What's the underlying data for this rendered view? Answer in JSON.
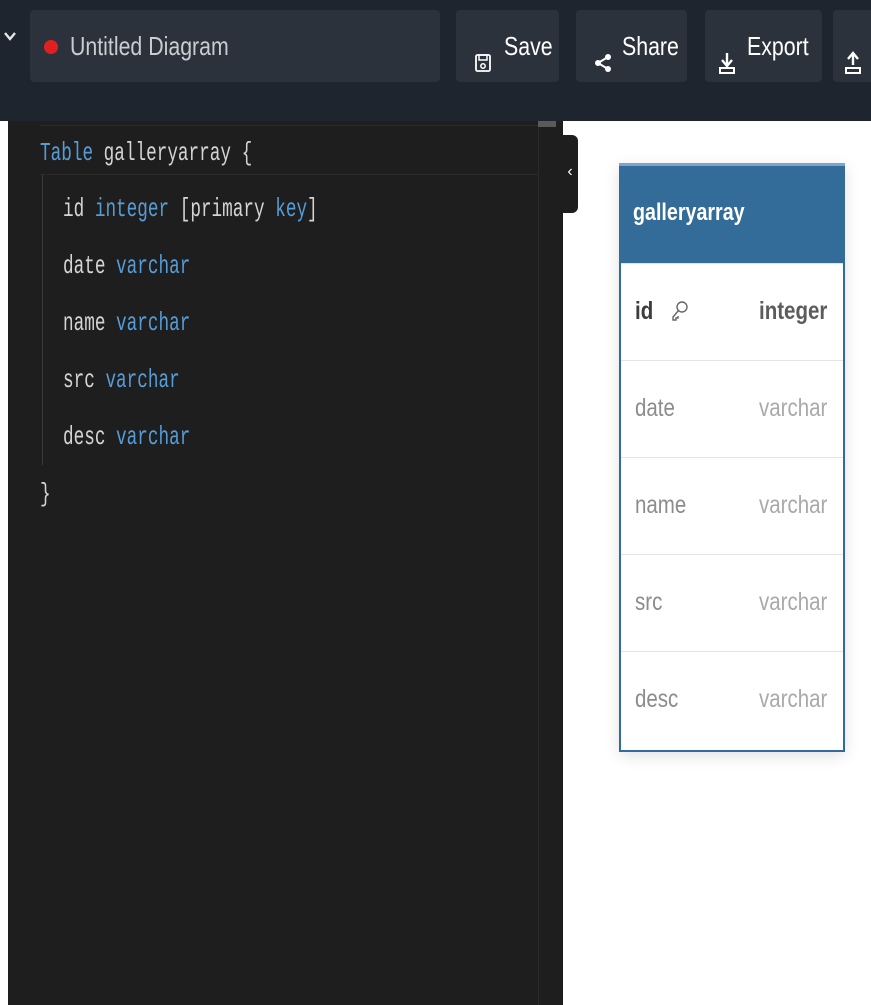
{
  "topbar": {
    "diagram_title": "Untitled Diagram",
    "save_label": "Save",
    "share_label": "Share",
    "export_label": "Export",
    "status_color": "#e02020"
  },
  "editor": {
    "lines": [
      {
        "parts": [
          {
            "text": "Table",
            "kind": "keyword"
          },
          {
            "text": " galleryarray {",
            "kind": "plain"
          }
        ]
      },
      {
        "parts": [
          {
            "text": "id",
            "kind": "plain"
          },
          {
            "text": " integer",
            "kind": "keyword"
          },
          {
            "text": " [primary",
            "kind": "plain"
          },
          {
            "text": " key",
            "kind": "keyword"
          },
          {
            "text": "]",
            "kind": "plain"
          }
        ]
      },
      {
        "parts": [
          {
            "text": "date",
            "kind": "plain"
          },
          {
            "text": " varchar",
            "kind": "keyword"
          }
        ]
      },
      {
        "parts": [
          {
            "text": "name",
            "kind": "plain"
          },
          {
            "text": " varchar",
            "kind": "keyword"
          }
        ]
      },
      {
        "parts": [
          {
            "text": "src",
            "kind": "plain"
          },
          {
            "text": " varchar",
            "kind": "keyword"
          }
        ]
      },
      {
        "parts": [
          {
            "text": "desc",
            "kind": "plain"
          },
          {
            "text": " varchar",
            "kind": "keyword"
          }
        ]
      },
      {
        "parts": [
          {
            "text": "}",
            "kind": "plain"
          }
        ]
      }
    ]
  },
  "diagram": {
    "table_name": "galleryarray",
    "fields": [
      {
        "name": "id",
        "type": "integer",
        "primary_key": true
      },
      {
        "name": "date",
        "type": "varchar",
        "primary_key": false
      },
      {
        "name": "name",
        "type": "varchar",
        "primary_key": false
      },
      {
        "name": "src",
        "type": "varchar",
        "primary_key": false
      },
      {
        "name": "desc",
        "type": "varchar",
        "primary_key": false
      }
    ],
    "header_color": "#336b99"
  },
  "icons": {
    "menu": "chevron-down-icon",
    "save": "floppy-disk-icon",
    "share": "share-icon",
    "export": "download-icon",
    "upload": "upload-icon",
    "collapse": "chevron-left-icon",
    "primary_key": "key-icon"
  }
}
